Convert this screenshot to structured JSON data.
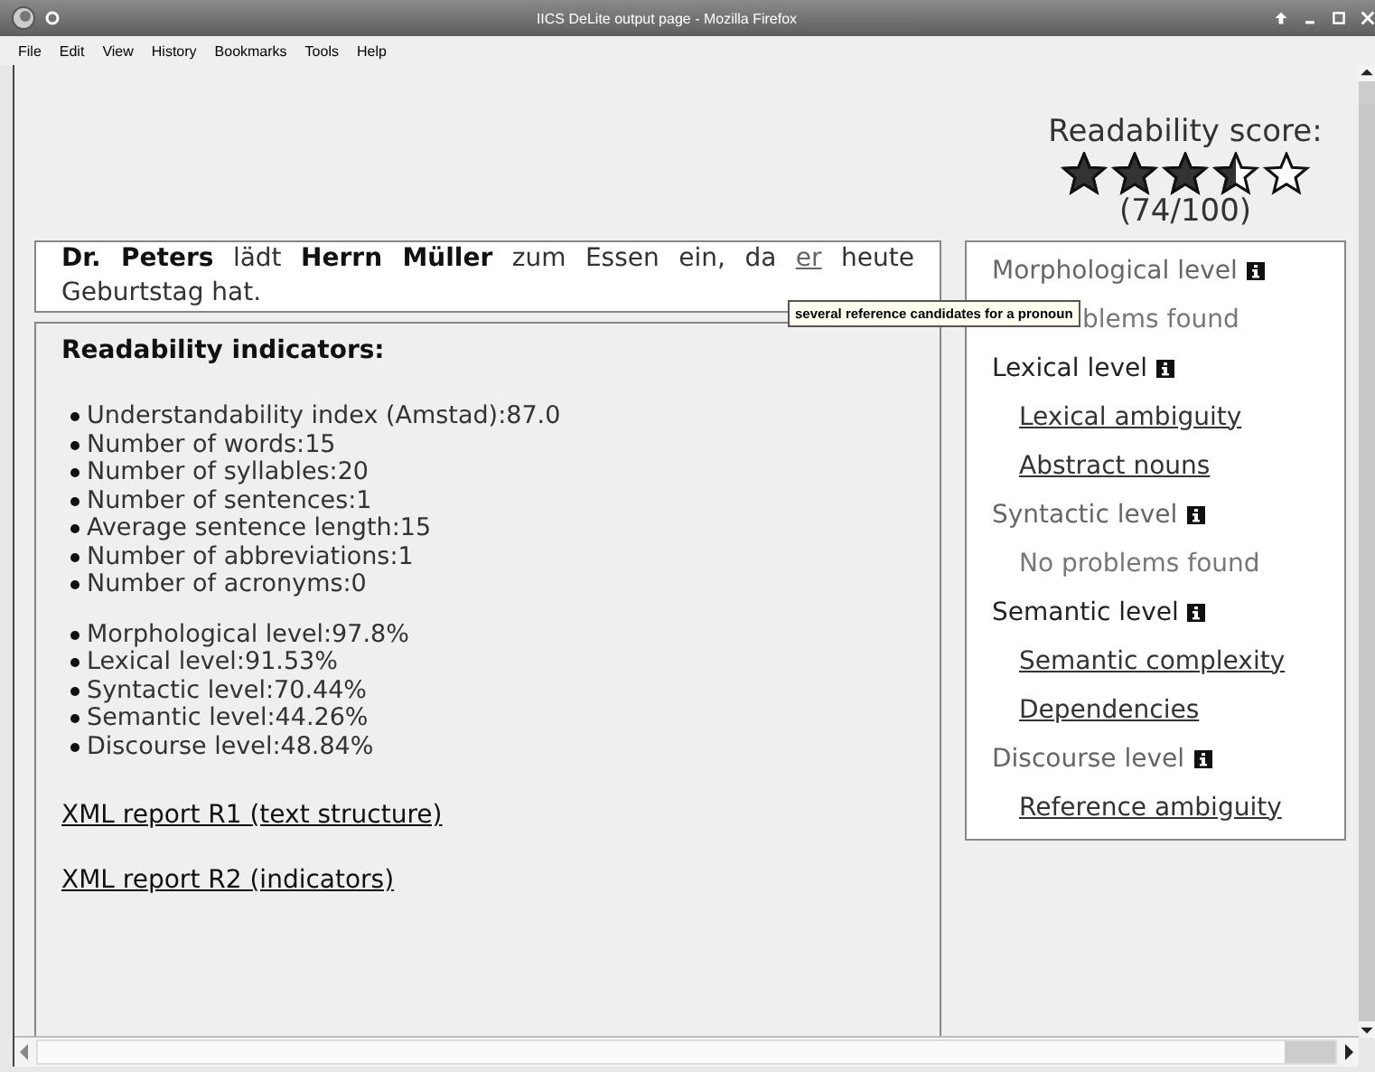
{
  "window": {
    "title": "IICS DeLite output page - Mozilla Firefox"
  },
  "menu": [
    {
      "label": "File"
    },
    {
      "label": "Edit"
    },
    {
      "label": "View"
    },
    {
      "label": "History"
    },
    {
      "label": "Bookmarks"
    },
    {
      "label": "Tools"
    },
    {
      "label": "Help"
    }
  ],
  "score": {
    "title": "Readability score:",
    "stars": 3.5,
    "reading": "(74/100)"
  },
  "sentence": [
    {
      "text": "Dr. Peters",
      "kind": "bold"
    },
    {
      "text": " lädt ",
      "kind": "plain"
    },
    {
      "text": "Herrn Müller",
      "kind": "bold"
    },
    {
      "text": " zum Essen ein, da ",
      "kind": "plain"
    },
    {
      "text": "er",
      "kind": "link"
    },
    {
      "text": " heute Geburtstag hat.",
      "kind": "plain"
    }
  ],
  "tooltip": "several reference candidates for a pronoun",
  "indicators": {
    "title": "Readability indicators:",
    "groups": [
      [
        "Understandability index (Amstad):87.0",
        "Number of words:15",
        "Number of syllables:20",
        "Number of sentences:1",
        "Average sentence length:15",
        "Number of abbreviations:1",
        "Number of acronyms:0"
      ],
      [
        "Morphological level:97.8%",
        "Lexical level:91.53%",
        "Syntactic level:70.44%",
        "Semantic level:44.26%",
        "Discourse level:48.84%"
      ]
    ]
  },
  "reports": [
    "XML report R1 (text structure)",
    "XML report R2 (indicators)"
  ],
  "levels": [
    {
      "name": "Morphological level",
      "highlighted": false,
      "items": [
        {
          "text": "blems found",
          "kind": "note",
          "covered": true
        }
      ]
    },
    {
      "name": "Lexical level",
      "highlighted": true,
      "items": [
        {
          "text": "Lexical ambiguity",
          "kind": "link"
        },
        {
          "text": "Abstract nouns",
          "kind": "link"
        }
      ]
    },
    {
      "name": "Syntactic level",
      "highlighted": false,
      "items": [
        {
          "text": "No problems found",
          "kind": "note"
        }
      ]
    },
    {
      "name": "Semantic level",
      "highlighted": true,
      "items": [
        {
          "text": "Semantic complexity",
          "kind": "link"
        },
        {
          "text": "Dependencies",
          "kind": "link"
        }
      ]
    },
    {
      "name": "Discourse level",
      "highlighted": false,
      "items": [
        {
          "text": "Reference ambiguity",
          "kind": "link"
        }
      ]
    }
  ]
}
